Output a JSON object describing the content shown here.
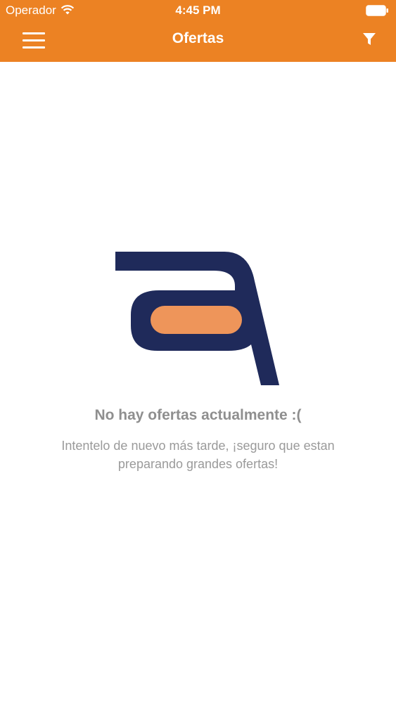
{
  "status_bar": {
    "carrier": "Operador",
    "time": "4:45 PM",
    "wifi_icon": "wifi-icon",
    "battery_icon": "battery-icon"
  },
  "nav_bar": {
    "title": "Ofertas",
    "menu_icon": "hamburger-menu-icon",
    "filter_icon": "filter-funnel-icon"
  },
  "empty_state": {
    "title": "No hay ofertas actualmente :(",
    "message": "Intentelo de nuevo más tarde, ¡seguro que estan preparando grandes ofertas!"
  },
  "colors": {
    "header_bg": "#ec8223",
    "logo_navy": "#1f2a5a",
    "logo_orange": "#ee955a",
    "text_gray": "#8f8f8f"
  }
}
